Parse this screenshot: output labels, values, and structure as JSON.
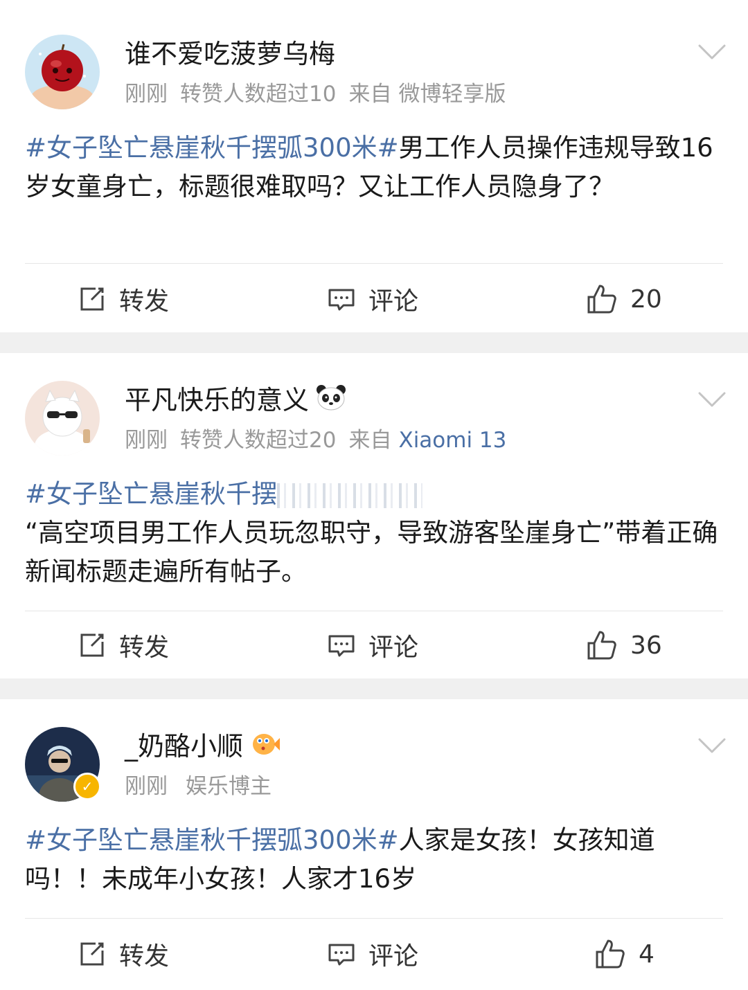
{
  "posts": [
    {
      "username": "谁不爱吃菠萝乌梅",
      "time": "刚刚",
      "repost_info": "转赞人数超过10",
      "source_prefix": "来自",
      "source": "微博轻享版",
      "hashtag": "#女子坠亡悬崖秋千摆弧300米#",
      "text": "男工作人员操作违规导致16岁女童身亡，标题很难取吗？又让工作人员隐身了？",
      "repost_label": "转发",
      "comment_label": "评论",
      "likes": "20"
    },
    {
      "username": "平凡快乐的意义",
      "badge_icon": "panda-emoji-icon",
      "time": "刚刚",
      "repost_info": "转赞人数超过20",
      "source_prefix": "来自",
      "source": "Xiaomi 13",
      "hashtag": "#女子坠亡悬崖秋千摆",
      "text": "“高空项目男工作人员玩忽职守，导致游客坠崖身亡”带着正确新闻标题走遍所有帖子。",
      "repost_label": "转发",
      "comment_label": "评论",
      "likes": "36"
    },
    {
      "username": "_奶酪小顺",
      "badge_icon": "pufferfish-emoji-icon",
      "verified": true,
      "time": "刚刚",
      "role": "娱乐博主",
      "hashtag": "#女子坠亡悬崖秋千摆弧300米#",
      "text": "人家是女孩！女孩知道吗！！未成年小女孩！人家才16岁",
      "repost_label": "转发",
      "comment_label": "评论",
      "likes": "4"
    }
  ],
  "colors": {
    "link": "#4a6fa5",
    "meta": "#999999",
    "text": "#1a1a1a",
    "separator": "#f0f0f0",
    "verified": "#f7b500"
  }
}
